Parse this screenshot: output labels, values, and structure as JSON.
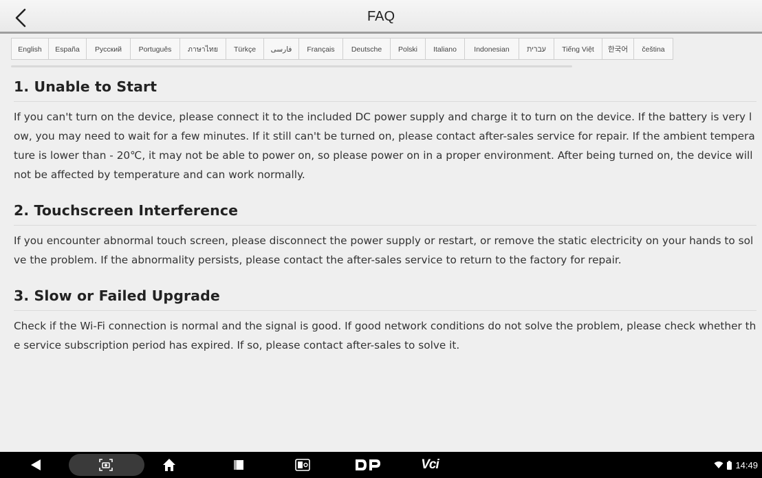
{
  "header": {
    "title": "FAQ",
    "back_icon": "chevron-left-icon"
  },
  "languages": [
    "English",
    "España",
    "Русский",
    "Português",
    "ภาษาไทย",
    "Türkçe",
    "فارسی",
    "Français",
    "Deutsche",
    "Polski",
    "Italiano",
    "Indonesian",
    "עברית",
    "Tiếng Việt",
    "한국어",
    "čeština"
  ],
  "sections": [
    {
      "title": "1. Unable to Start",
      "body": "If you can't turn on the device, please connect it to the included DC power supply and charge it to turn on the device. If the battery is very low, you may need to wait for a few minutes. If it still can't be turned on, please contact after-sales service for repair. If the ambient temperature is lower than - 20℃, it may not be able to power on, so please power on in a proper environment. After being turned on, the device will not be affected by temperature and can work normally."
    },
    {
      "title": "2. Touchscreen Interference",
      "body": "If you encounter abnormal touch screen, please disconnect the power supply or restart, or remove the static electricity on your hands to solve the problem. If the abnormality persists, please contact the after-sales service to return to the factory for repair."
    },
    {
      "title": "3. Slow or Failed Upgrade",
      "body": "Check if the Wi-Fi connection is normal and the signal is good. If good network conditions do not solve the problem, please check whether the service subscription period has expired. If so, please contact after-sales to solve it."
    }
  ],
  "navbar": {
    "icons": [
      "back-triangle-icon",
      "screenshot-icon",
      "home-icon",
      "recents-icon",
      "diagnostic-app-icon",
      "dp-app-icon",
      "vci-icon"
    ],
    "vci_label": "Vci",
    "status": {
      "wifi_icon": "wifi-icon",
      "battery_icon": "battery-icon",
      "time": "14:49"
    }
  },
  "colors": {
    "background": "#efefef",
    "navbar": "#000000",
    "accent_border": "#9e9e9e"
  }
}
